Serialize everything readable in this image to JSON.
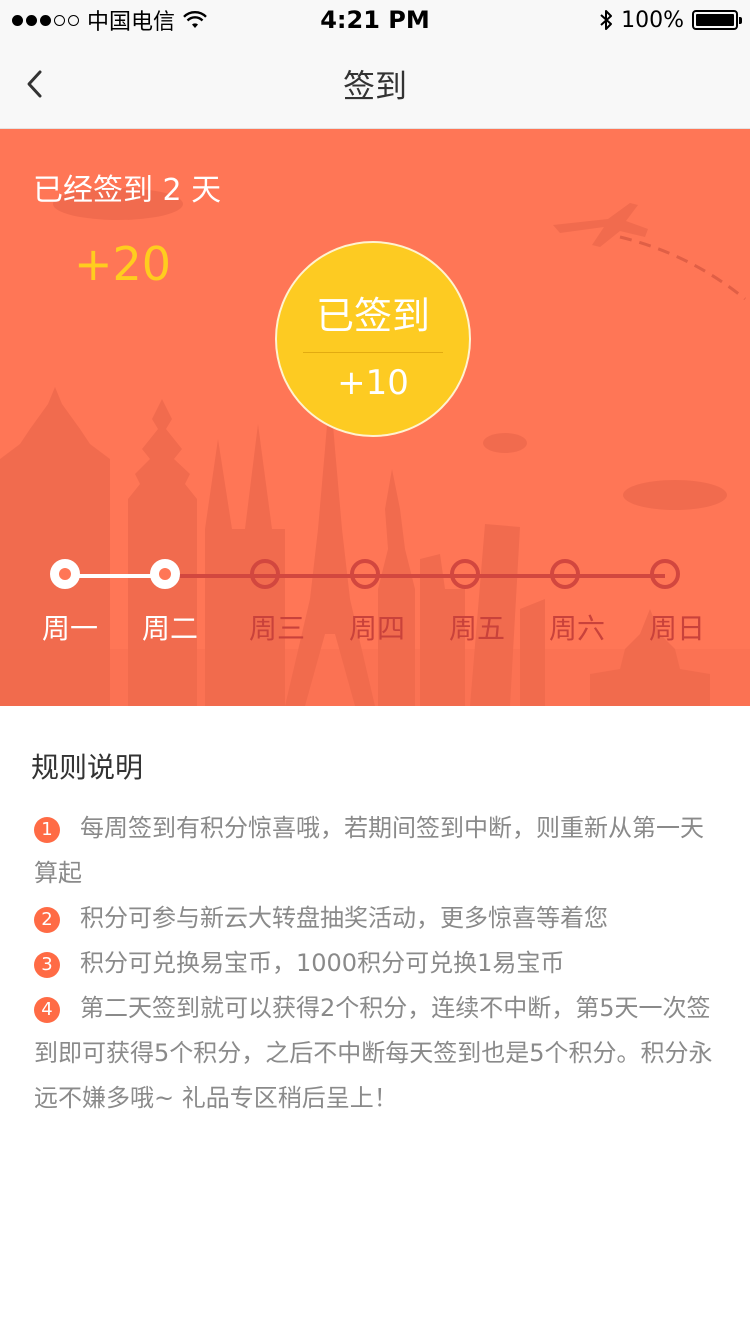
{
  "status_bar": {
    "carrier": "中国电信",
    "time": "4:21 PM",
    "battery": "100%",
    "signal_strength": 3,
    "signal_total": 5
  },
  "nav": {
    "title": "签到",
    "back_icon": "chevron-left-icon"
  },
  "hero": {
    "signed_days_text": "已经签到 2 天",
    "bonus_text": "+20",
    "button_label": "已签到",
    "button_points": "+10",
    "colors": {
      "background": "#ff7656",
      "accent_yellow": "#fdcb22",
      "pending": "#d2473f"
    },
    "week": [
      {
        "label": "周一",
        "done": true
      },
      {
        "label": "周二",
        "done": true
      },
      {
        "label": "周三",
        "done": false
      },
      {
        "label": "周四",
        "done": false
      },
      {
        "label": "周五",
        "done": false
      },
      {
        "label": "周六",
        "done": false
      },
      {
        "label": "周日",
        "done": false
      }
    ]
  },
  "rules": {
    "title": "规则说明",
    "items": [
      {
        "num": "1",
        "text": "每周签到有积分惊喜哦，若期间签到中断，则重新从第一天算起"
      },
      {
        "num": "2",
        "text": "积分可参与新云大转盘抽奖活动，更多惊喜等着您"
      },
      {
        "num": "3",
        "text": "积分可兑换易宝币，1000积分可兑换1易宝币"
      },
      {
        "num": "4",
        "text": "第二天签到就可以获得2个积分，连续不中断，第5天一次签到即可获得5个积分，之后不中断每天签到也是5个积分。积分永远不嫌多哦~ 礼品专区稍后呈上！"
      }
    ]
  }
}
